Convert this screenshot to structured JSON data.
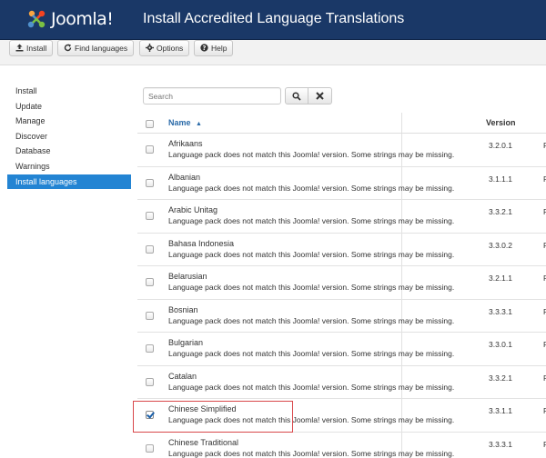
{
  "header": {
    "logo_text": "Joomla!",
    "title": "Install Accredited Language Translations"
  },
  "toolbar": {
    "install_label": "Install",
    "find_languages_label": "Find languages",
    "options_label": "Options",
    "help_label": "Help"
  },
  "sidebar": {
    "items": [
      {
        "label": "Install",
        "active": false
      },
      {
        "label": "Update",
        "active": false
      },
      {
        "label": "Manage",
        "active": false
      },
      {
        "label": "Discover",
        "active": false
      },
      {
        "label": "Database",
        "active": false
      },
      {
        "label": "Warnings",
        "active": false
      },
      {
        "label": "Install languages",
        "active": true
      }
    ]
  },
  "search": {
    "placeholder": "Search"
  },
  "table": {
    "columns": {
      "name": "Name",
      "version": "Version"
    },
    "rows": [
      {
        "name": "Afrikaans",
        "message": "Language pack does not match this Joomla! version. Some strings may be missing.",
        "version": "3.2.0.1",
        "trailing": "F",
        "checked": false
      },
      {
        "name": "Albanian",
        "message": "Language pack does not match this Joomla! version. Some strings may be missing.",
        "version": "3.1.1.1",
        "trailing": "F",
        "checked": false
      },
      {
        "name": "Arabic Unitag",
        "message": "Language pack does not match this Joomla! version. Some strings may be missing.",
        "version": "3.3.2.1",
        "trailing": "F",
        "checked": false
      },
      {
        "name": "Bahasa Indonesia",
        "message": "Language pack does not match this Joomla! version. Some strings may be missing.",
        "version": "3.3.0.2",
        "trailing": "F",
        "checked": false
      },
      {
        "name": "Belarusian",
        "message": "Language pack does not match this Joomla! version. Some strings may be missing.",
        "version": "3.2.1.1",
        "trailing": "F",
        "checked": false
      },
      {
        "name": "Bosnian",
        "message": "Language pack does not match this Joomla! version. Some strings may be missing.",
        "version": "3.3.3.1",
        "trailing": "F",
        "checked": false
      },
      {
        "name": "Bulgarian",
        "message": "Language pack does not match this Joomla! version. Some strings may be missing.",
        "version": "3.3.0.1",
        "trailing": "F",
        "checked": false
      },
      {
        "name": "Catalan",
        "message": "Language pack does not match this Joomla! version. Some strings may be missing.",
        "version": "3.3.2.1",
        "trailing": "F",
        "checked": false
      },
      {
        "name": "Chinese Simplified",
        "message": "Language pack does not match this Joomla! version. Some strings may be missing.",
        "version": "3.3.1.1",
        "trailing": "F",
        "checked": true
      },
      {
        "name": "Chinese Traditional",
        "message": "Language pack does not match this Joomla! version. Some strings may be missing.",
        "version": "3.3.3.1",
        "trailing": "F",
        "checked": false
      }
    ]
  },
  "colors": {
    "header_bg": "#1a3867",
    "active_sidebar": "#2384d3",
    "highlight_border": "#d8474a",
    "link_blue": "#2a6aa8"
  }
}
